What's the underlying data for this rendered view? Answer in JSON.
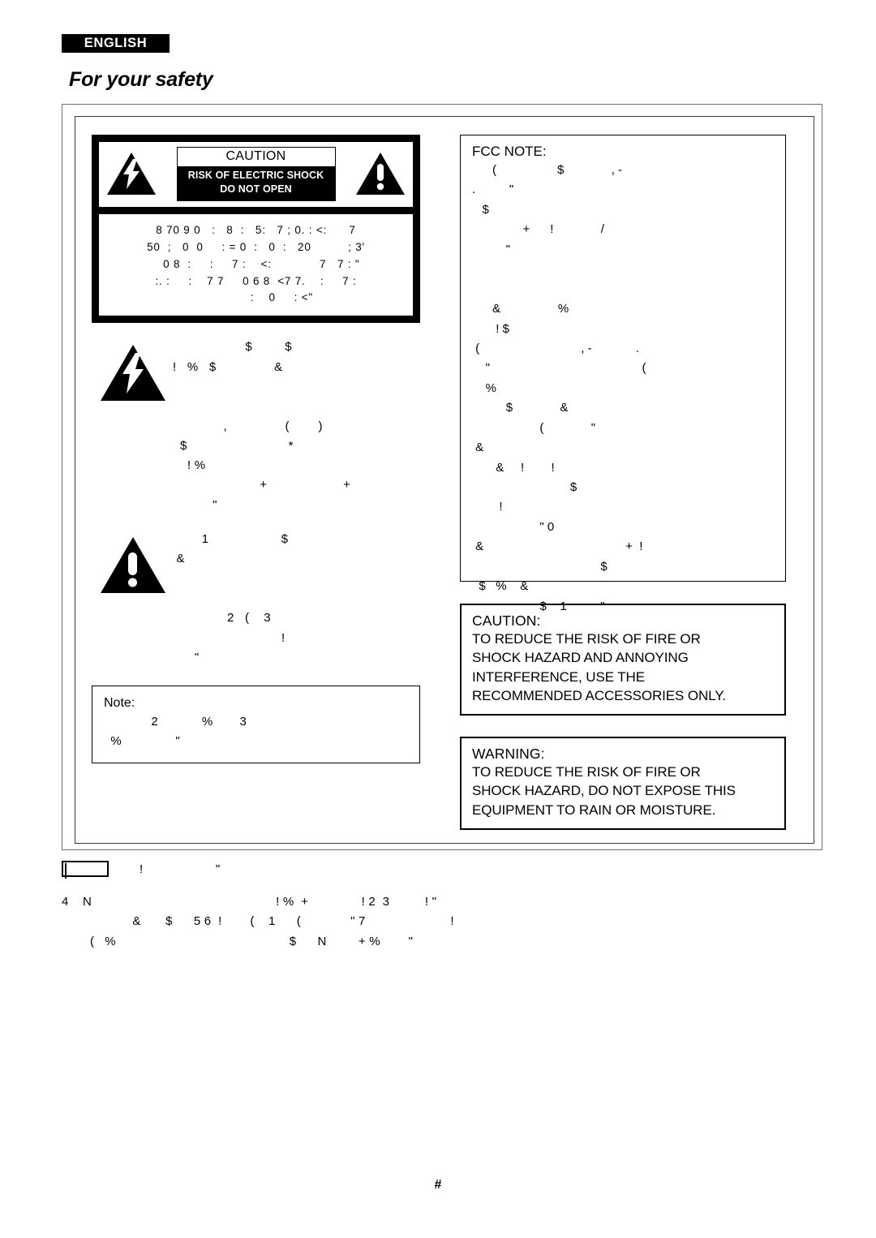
{
  "header": {
    "language_badge": "ENGLISH",
    "title": "For your safety"
  },
  "shock_label": {
    "caution_head": "CAUTION",
    "caution_body_line1": "RISK OF ELECTRIC SHOCK",
    "caution_body_line2": "DO NOT OPEN",
    "left_icon": "lightning-bolt-triangle-icon",
    "right_icon": "exclamation-triangle-icon",
    "body_text": "8 70 9 0   :   8  :   5:   7 ; 0. : <:      7\n50  ;   0  0     : = 0  :   0  :   20          ; 3'\n   0 8  :     :     7 :    <:             7   7 : \"\n:. :     :    7 7     0 6 8  <7 7.    :     7 :\n              :    0     : <\""
  },
  "bolt_block": {
    "icon": "lightning-bolt-triangle-icon",
    "text": "                    $         $\n!   %   $                &\n\n\n              ,                (        )\n  $                            *\n    ! %\n                        +                     +\n           \""
  },
  "exclaim_block": {
    "icon": "exclamation-triangle-icon",
    "text": "        1                    $\n &\n\n\n               2   (    3\n                              !\n      \""
  },
  "note_box": {
    "title": "Note:",
    "text": "              2             %        3\n  %                \""
  },
  "fcc_box": {
    "title": "FCC NOTE:",
    "text": "      (                  $              , -\n.          \"\n   $\n               +      !              /\n          \"\n\n\n      &                 %\n       ! $\n (                              , -             .\n    \"                                             (\n    %\n          $              &\n                    (              \"\n &\n       &     !        !\n                             $\n        !\n                    \" 0\n &                                          +  !\n                                      $\n  $   %    &\n                    $    1          \""
  },
  "caution_alert": {
    "heading": "CAUTION:",
    "body": "TO REDUCE THE RISK OF FIRE OR\nSHOCK HAZARD AND ANNOYING\nINTERFERENCE, USE THE\nRECOMMENDED ACCESSORIES ONLY."
  },
  "warning_alert": {
    "heading": "WARNING:",
    "body": "TO REDUCE THE RISK OF FIRE OR\nSHOCK HAZARD, DO NOT EXPOSE THIS\nEQUIPMENT TO RAIN OR MOISTURE."
  },
  "footer": {
    "class2_icon": "double-insulation-square-icon",
    "row1_text": "!                    \"",
    "body_text": "4    N                                                    ! %  +               ! 2  3          ! \"\n                    &       $      5 6  !        (    1      (              \" 7                        !\n        (   %                                                 $      N         + %        \""
  },
  "page_number": "#"
}
